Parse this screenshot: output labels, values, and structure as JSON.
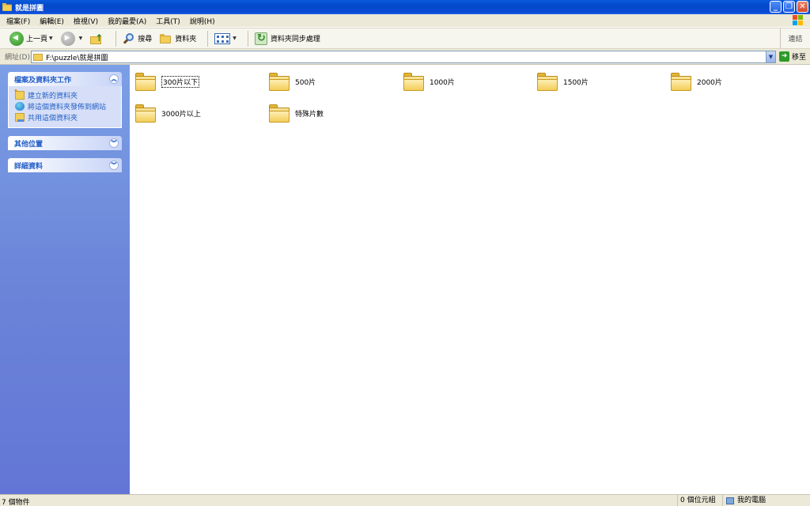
{
  "window": {
    "title": "就是拼圖"
  },
  "menu": [
    "檔案(F)",
    "編輯(E)",
    "檢視(V)",
    "我的最愛(A)",
    "工具(T)",
    "說明(H)"
  ],
  "toolbar": {
    "back_label": "上一頁",
    "search_label": "搜尋",
    "folders_label": "資料夾",
    "sync_label": "資料夾同步處理",
    "links_label": "連結"
  },
  "address": {
    "label": "網址(D)",
    "value": "F:\\puzzle\\就是拼圖",
    "go_label": "移至"
  },
  "taskpane": {
    "file_tasks": {
      "title": "檔案及資料夾工作",
      "items": [
        "建立新的資料夾",
        "將這個資料夾發佈到網站",
        "共用這個資料夾"
      ]
    },
    "other_places": {
      "title": "其他位置"
    },
    "details": {
      "title": "詳細資料"
    }
  },
  "folders": [
    "300片以下",
    "500片",
    "1000片",
    "1500片",
    "2000片",
    "3000片以上",
    "特殊片數"
  ],
  "status": {
    "objects": "7 個物件",
    "size": "0 個位元組",
    "location": "我的電腦"
  },
  "colors": {
    "titlebar": "#0348c9",
    "taskpane": "#6b85d8",
    "task_link": "#215dc6",
    "folder": "#f0c64b"
  }
}
